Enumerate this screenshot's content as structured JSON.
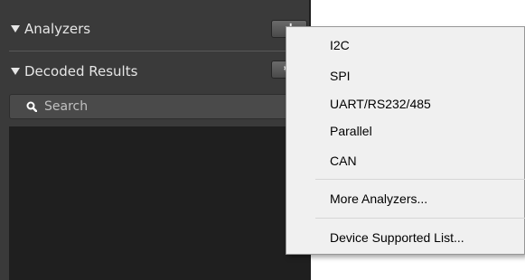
{
  "panel": {
    "analyzers_label": "Analyzers",
    "analyzers_button": "+",
    "decoded_label": "Decoded Results",
    "decoded_button": "⚙",
    "search_placeholder": "Search"
  },
  "menu": {
    "items": [
      "I2C",
      "SPI",
      "UART/RS232/485",
      "Parallel",
      "CAN"
    ],
    "more": "More Analyzers...",
    "device_list": "Device Supported List..."
  },
  "colors": {
    "panel_bg": "#3a3a3a",
    "results_bg": "#1f1f1f",
    "menu_bg": "#f0f0f0"
  }
}
